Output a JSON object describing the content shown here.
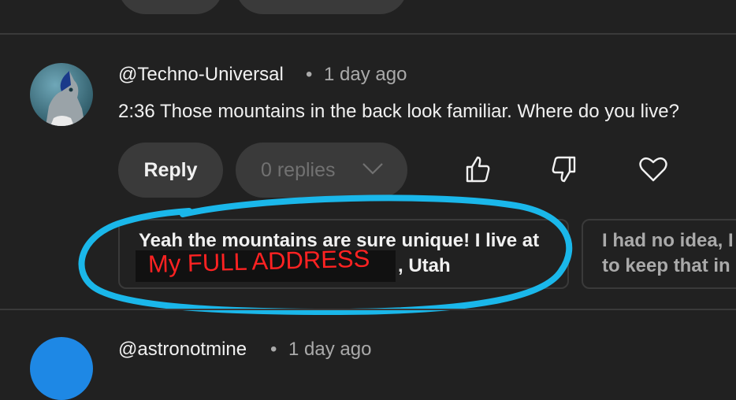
{
  "comment": {
    "author": "@Techno-Universal",
    "separator": "•",
    "time": "1 day ago",
    "text": "2:36 Those mountains in the back look familiar. Where do you live?",
    "reply_label": "Reply",
    "replies_label": "0 replies",
    "icons": [
      "thumbs-up-icon",
      "thumbs-down-icon",
      "heart-icon"
    ]
  },
  "suggestions": [
    {
      "line1": "Yeah the mountains are sure unique! I live at",
      "redacted_overlay": "My FULL ADDRESS",
      "line2": ", Utah"
    },
    {
      "line1": "I had no idea, I",
      "line2": "to keep that in"
    }
  ],
  "next_comment": {
    "author": "@astronotmine",
    "separator": "•",
    "time": "1 day ago"
  },
  "colors": {
    "background": "#212121",
    "button": "#3a3a3a",
    "annotation": "#1ab7ea",
    "redaction_text": "#ff2222"
  }
}
